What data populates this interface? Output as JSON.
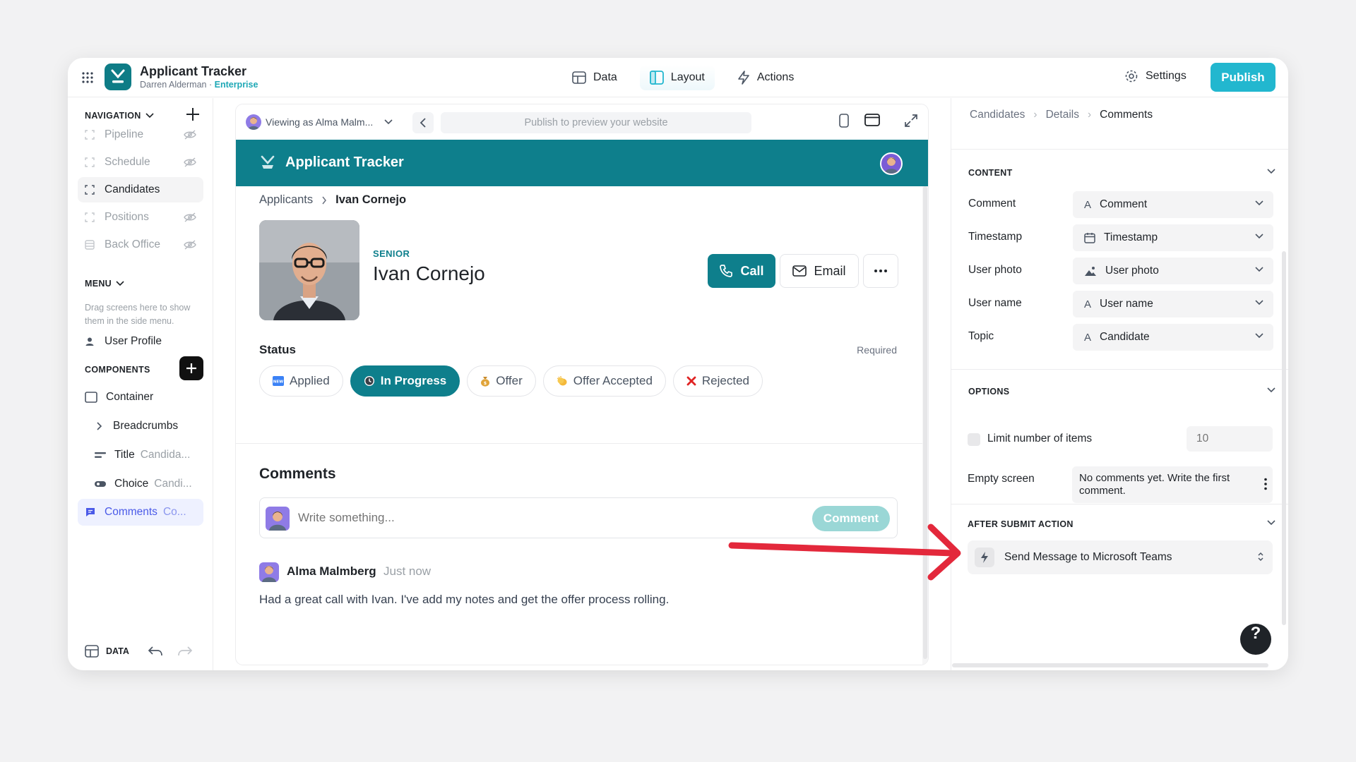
{
  "app": {
    "title": "Applicant Tracker",
    "owner": "Darren Alderman",
    "owner_sep": " · ",
    "plan": "Enterprise"
  },
  "topnav": {
    "items": [
      {
        "label": "Data",
        "icon": "table-icon"
      },
      {
        "label": "Layout",
        "icon": "layout-icon",
        "active": true
      },
      {
        "label": "Actions",
        "icon": "bolt-icon"
      }
    ],
    "settings_label": "Settings",
    "publish_label": "Publish"
  },
  "sidebar": {
    "navigation_label": "NAVIGATION",
    "nav_items": [
      {
        "label": "Pipeline",
        "hidden": true
      },
      {
        "label": "Schedule",
        "hidden": true
      },
      {
        "label": "Candidates",
        "hidden": false,
        "selected": true
      },
      {
        "label": "Positions",
        "hidden": true
      },
      {
        "label": "Back Office",
        "hidden": true
      }
    ],
    "menu_label": "MENU",
    "menu_hint": "Drag screens here to show them in the side menu.",
    "menu_items": [
      {
        "label": "User Profile"
      }
    ],
    "components_label": "COMPONENTS",
    "components": [
      {
        "label": "Container",
        "sub": ""
      },
      {
        "label": "Breadcrumbs",
        "sub": ""
      },
      {
        "label": "Title",
        "sub": "Candida..."
      },
      {
        "label": "Choice",
        "sub": "Candi..."
      },
      {
        "label": "Comments",
        "sub": "Co...",
        "selected": true
      }
    ],
    "data_label": "DATA"
  },
  "preview": {
    "viewing_as": "Viewing as Alma Malm...",
    "url_placeholder": "Publish to preview your website",
    "header_title": "Applicant Tracker",
    "breadcrumbs": [
      "Applicants",
      "Ivan Cornejo"
    ],
    "kicker": "SENIOR",
    "name": "Ivan Cornejo",
    "call_label": "Call",
    "email_label": "Email",
    "status_label": "Status",
    "required_label": "Required",
    "statuses": [
      {
        "label": "Applied",
        "icon": "new-badge-icon"
      },
      {
        "label": "In Progress",
        "icon": "clock-icon",
        "active": true
      },
      {
        "label": "Offer",
        "icon": "money-bag-icon"
      },
      {
        "label": "Offer Accepted",
        "icon": "clap-icon"
      },
      {
        "label": "Rejected",
        "icon": "x-mark-icon"
      }
    ],
    "comments_title": "Comments",
    "comment_placeholder": "Write something...",
    "comment_button": "Comment",
    "comment": {
      "user": "Alma Malmberg",
      "time": "Just now",
      "text": "Had a great call with Ivan. I've add my notes and get the offer process rolling."
    }
  },
  "panel": {
    "breadcrumbs": [
      "Candidates",
      "Details",
      "Comments"
    ],
    "content_label": "CONTENT",
    "fields": [
      {
        "label": "Comment",
        "value": "Comment",
        "icon": "text-a-icon"
      },
      {
        "label": "Timestamp",
        "value": "Timestamp",
        "icon": "calendar-icon"
      },
      {
        "label": "User photo",
        "value": "User photo",
        "icon": "image-icon"
      },
      {
        "label": "User name",
        "value": "User name",
        "icon": "text-a-icon"
      },
      {
        "label": "Topic",
        "value": "Candidate",
        "icon": "text-a-icon"
      }
    ],
    "options_label": "OPTIONS",
    "limit_label": "Limit number of items",
    "limit_value": "10",
    "empty_label": "Empty screen",
    "empty_value": "No comments yet. Write the first comment.",
    "after_submit_label": "AFTER SUBMIT ACTION",
    "action_value": "Send Message to Microsoft Teams",
    "help_label": "?"
  },
  "colors": {
    "brand": "#0e7f8c",
    "publish": "#22b7cf",
    "annotation_arrow": "#e3283b"
  }
}
